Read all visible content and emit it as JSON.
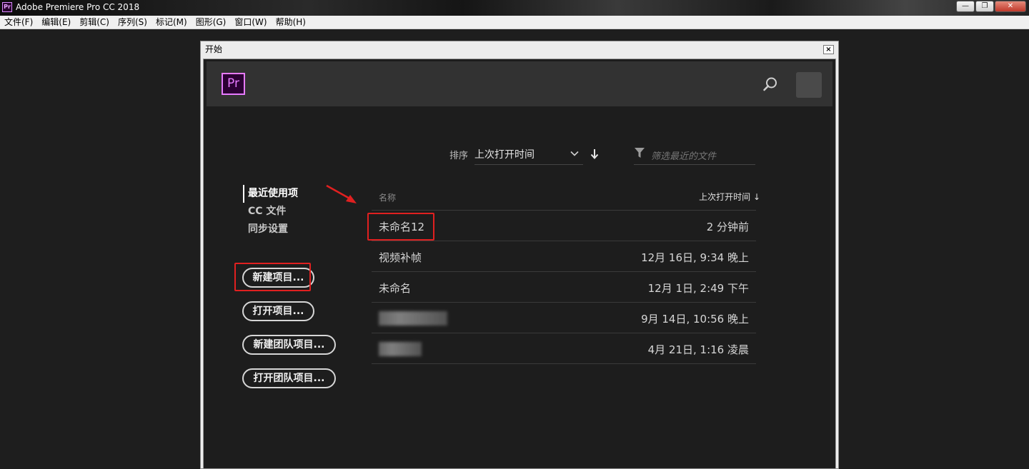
{
  "window": {
    "app_title": "Adobe Premiere Pro CC 2018",
    "app_icon": "Pr",
    "controls": {
      "minimize": "—",
      "restore": "❐",
      "close": "✕"
    }
  },
  "menubar": {
    "items": [
      "文件(F)",
      "编辑(E)",
      "剪辑(C)",
      "序列(S)",
      "标记(M)",
      "图形(G)",
      "窗口(W)",
      "帮助(H)"
    ]
  },
  "dialog": {
    "title": "开始",
    "close": "×",
    "logo": "Pr",
    "sort": {
      "label": "排序",
      "value": "上次打开时间"
    },
    "filter": {
      "placeholder": "筛选最近的文件"
    },
    "nav": [
      "最近使用项",
      "CC 文件",
      "同步设置"
    ],
    "buttons": {
      "new_project": "新建项目...",
      "open_project": "打开项目...",
      "new_team_project": "新建团队项目...",
      "open_team_project": "打开团队项目..."
    },
    "table": {
      "col_name": "名称",
      "col_time": "上次打开时间",
      "rows": [
        {
          "name": "未命名12",
          "time": "2 分钟前"
        },
        {
          "name": "视频补帧",
          "time": "12月 16日, 9:34 晚上"
        },
        {
          "name": "未命名",
          "time": "12月 1日, 2:49 下午"
        },
        {
          "name": "",
          "time": "9月 14日, 10:56 晚上"
        },
        {
          "name": "",
          "time": "4月 21日, 1:16 凌晨"
        }
      ]
    }
  },
  "colors": {
    "accent": "#e77bff",
    "highlight": "#e02020",
    "panel": "#1d1d1d",
    "header": "#323232"
  }
}
